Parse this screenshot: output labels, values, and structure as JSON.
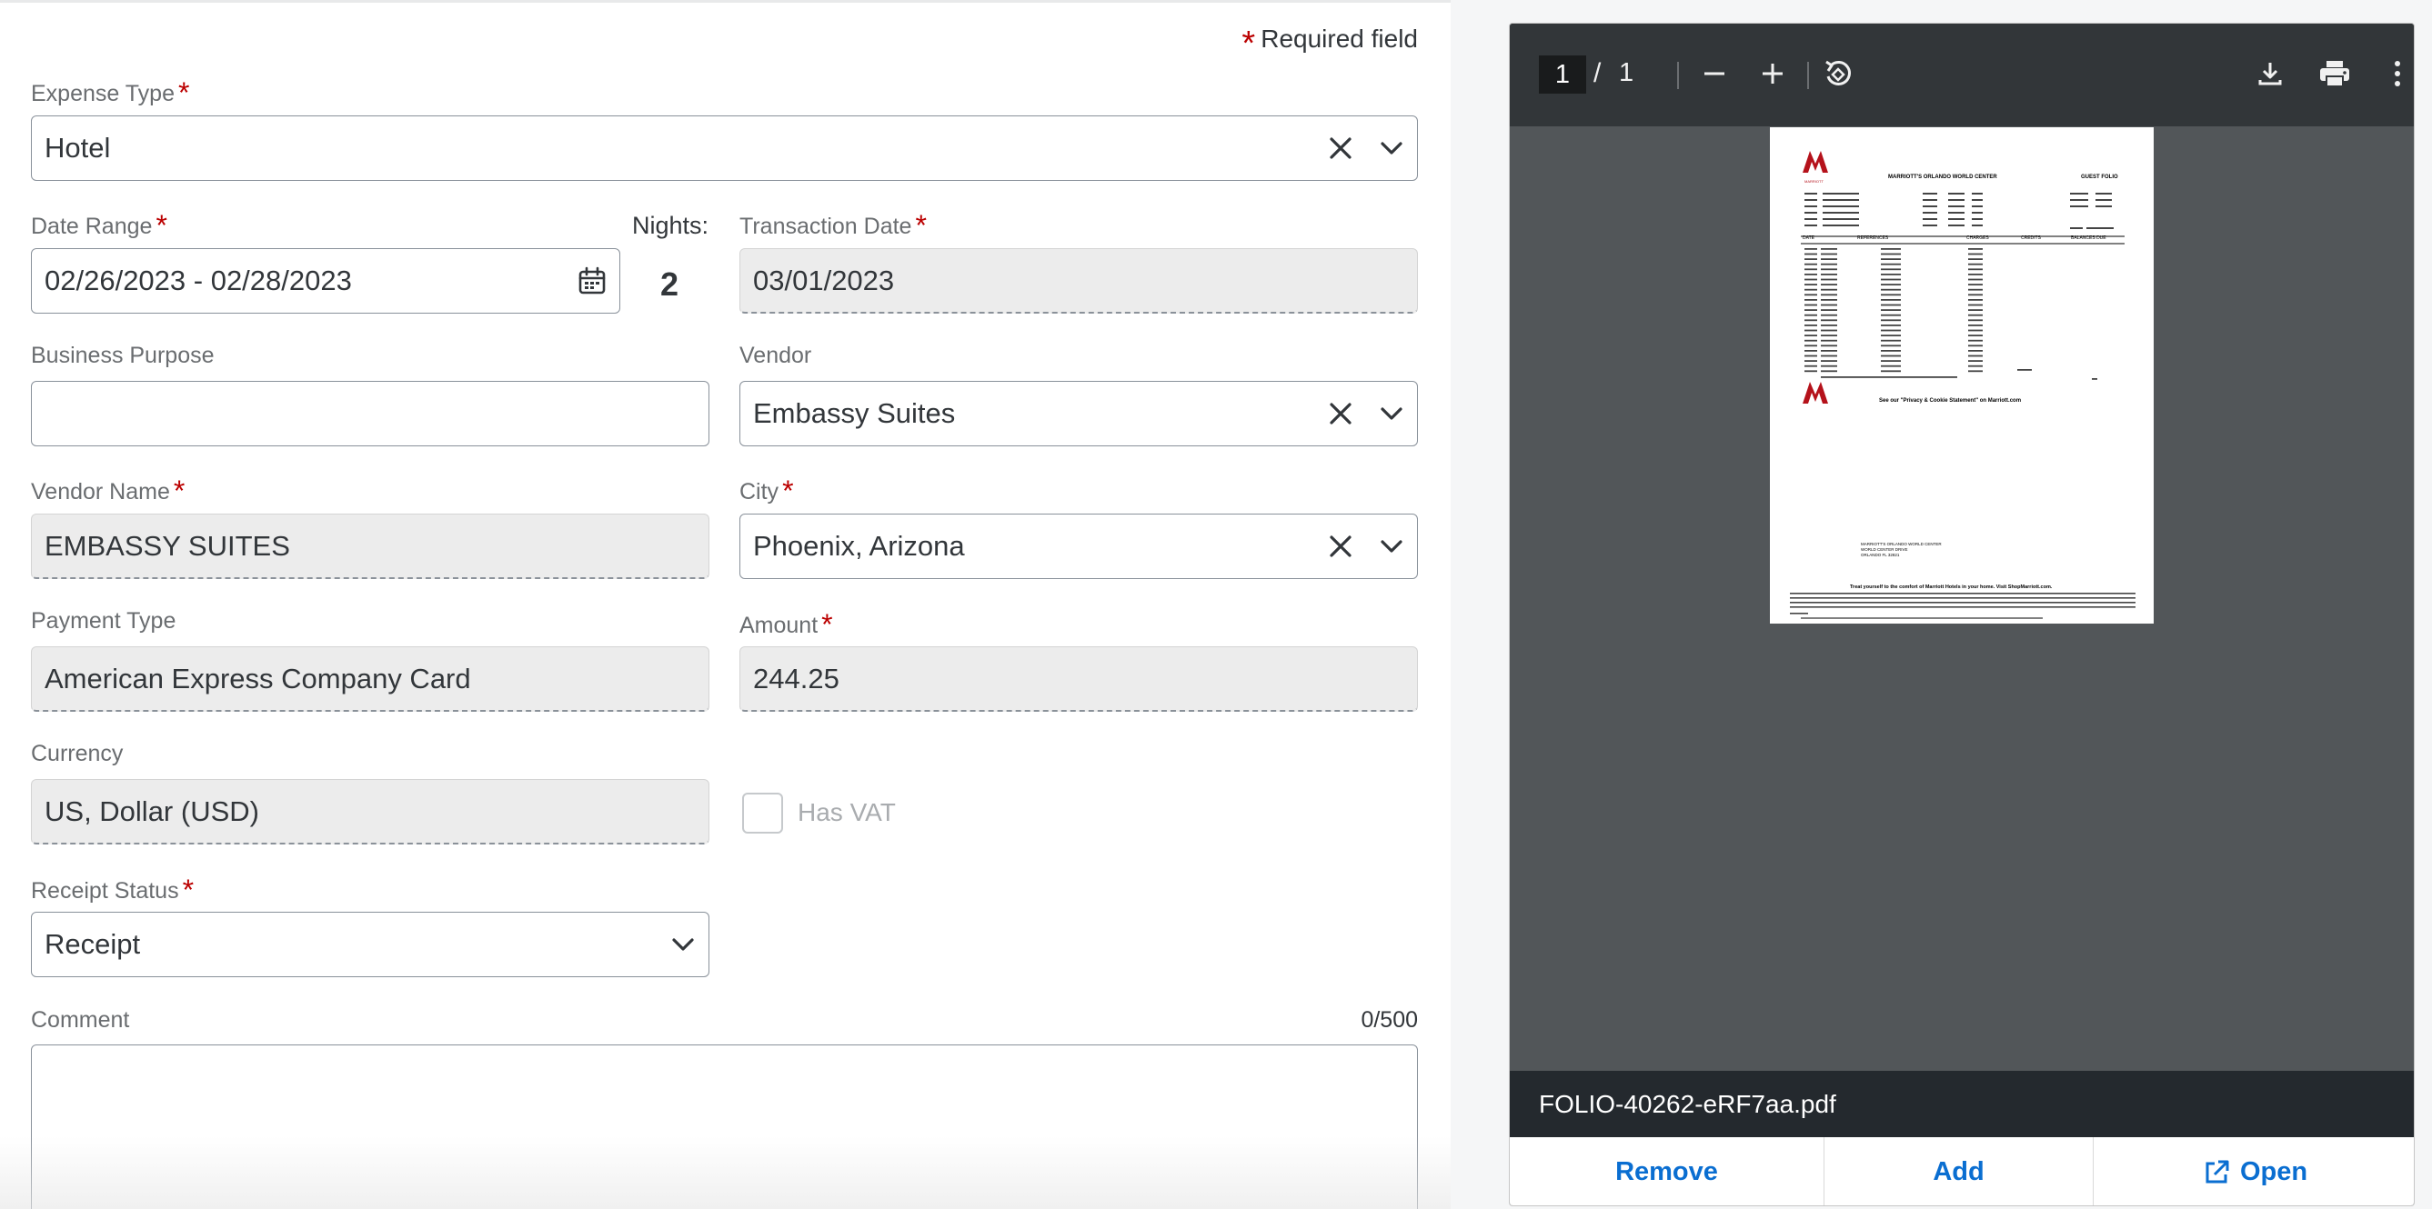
{
  "form": {
    "required_note": "Required field",
    "required_marker": "*",
    "expense_type": {
      "label": "Expense Type",
      "value": "Hotel"
    },
    "date_range": {
      "label": "Date Range",
      "value": "02/26/2023 - 02/28/2023"
    },
    "nights": {
      "label": "Nights:",
      "value": "2"
    },
    "transaction_date": {
      "label": "Transaction Date",
      "value": "03/01/2023"
    },
    "business_purpose": {
      "label": "Business Purpose",
      "value": ""
    },
    "vendor": {
      "label": "Vendor",
      "value": "Embassy Suites"
    },
    "vendor_name": {
      "label": "Vendor Name",
      "value": "EMBASSY SUITES"
    },
    "city": {
      "label": "City",
      "value": "Phoenix, Arizona"
    },
    "payment_type": {
      "label": "Payment Type",
      "value": "American Express Company Card"
    },
    "amount": {
      "label": "Amount",
      "value": "244.25"
    },
    "currency": {
      "label": "Currency",
      "value": "US, Dollar (USD)"
    },
    "has_vat": {
      "label": "Has VAT",
      "checked": false
    },
    "receipt_status": {
      "label": "Receipt Status",
      "value": "Receipt"
    },
    "comment": {
      "label": "Comment",
      "counter": "0/500",
      "value": ""
    }
  },
  "viewer": {
    "current_page": "1",
    "page_separator": "/",
    "total_pages": "1",
    "filename": "FOLIO-40262-eRF7aa.pdf",
    "actions": {
      "remove": "Remove",
      "add": "Add",
      "open": "Open"
    },
    "toolbar_icons": [
      "minus-icon",
      "plus-icon",
      "rotate-icon",
      "download-icon",
      "print-icon",
      "more-vertical-icon"
    ],
    "document": {
      "hotel_name": "MARRIOTT'S ORLANDO WORLD CENTER",
      "doc_title": "GUEST FOLIO",
      "brand": "MARRIOTT",
      "privacy_note": "See our \"Privacy & Cookie Statement\" on Marriott.com",
      "footer_tagline": "Treat yourself to the comfort of Marriott Hotels in your home. Visit ShopMarriott.com.",
      "footer_address_1": "MARRIOTT'S ORLANDO WORLD CENTER",
      "footer_address_2": "WORLD CENTER DRIVE",
      "footer_address_3": "ORLANDO FL 32821",
      "table_headers": [
        "DATE",
        "REFERENCES",
        "CHARGES",
        "CREDITS",
        "BALANCES DUE"
      ]
    }
  },
  "colors": {
    "required": "#bb0000",
    "link": "#0a6ed1",
    "toolbar": "#323639",
    "viewer_bg": "#525659",
    "footer_bg": "#24292e"
  }
}
